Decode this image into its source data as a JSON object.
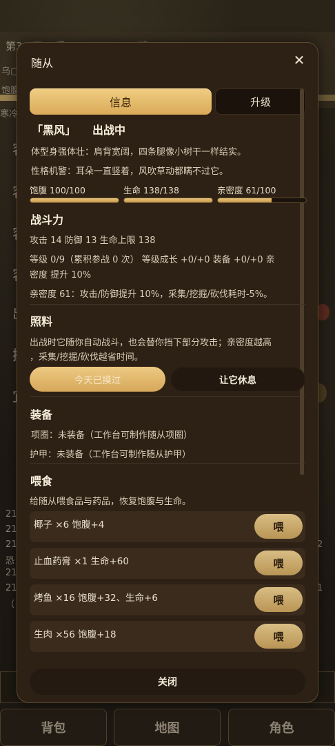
{
  "background": {
    "header_text": "第3▢天  ▢季  ▢▢:▢▢  ▢▢  晴▢",
    "sub_line_1": "乌▢",
    "sub_line_2": "饱腹",
    "sub_line_3": "寒冷",
    "side_chars": [
      "容",
      "容",
      "容",
      "容",
      "出",
      "挤",
      "宜"
    ],
    "log_left": [
      "21",
      "21",
      "21",
      "恐",
      "21",
      "21",
      "（"
    ],
    "log_right": [
      "2",
      "1"
    ],
    "nav": [
      "背包",
      "地图",
      "角色"
    ]
  },
  "modal": {
    "title": "随从",
    "close_icon": "close-icon",
    "tabs": {
      "info": "信息",
      "upgrade": "升级"
    },
    "pet_name": "「黑风」",
    "pet_status": "出战中",
    "desc_1": "体型身强体壮：肩背宽阔，四条腿像小树干一样结实。",
    "desc_2": "性格机警：耳朵一直竖着，风吹草动都瞒不过它。",
    "stats": [
      {
        "label": "饱腹 100/100",
        "fill": 1.0
      },
      {
        "label": "生命 138/138",
        "fill": 1.0
      },
      {
        "label": "亲密度 61/100",
        "fill": 0.61
      }
    ],
    "combat": {
      "title": "战斗力",
      "line_1": "攻击 14    防御 13    生命上限 138",
      "line_2": "等级 0/9（累积参战 0 次）     等级成长 +0/+0     装备 +0/+0     亲",
      "line_3": "密度 提升 10%",
      "line_4": "亲密度 61：攻击/防御提升 10%，采集/挖掘/砍伐耗时-5%。"
    },
    "care": {
      "title": "照料",
      "line_1": "出战时它随你自动战斗，也会替你挡下部分攻击；亲密度越高",
      "line_2": "，采集/挖掘/砍伐越省时间。",
      "pet_button": "今天已摸过",
      "rest_button": "让它休息"
    },
    "equipment": {
      "title": "装备",
      "collar": "项圈：未装备（工作台可制作随从项圈）",
      "armor": "护甲：未装备（工作台可制作随从护甲）"
    },
    "feeding": {
      "title": "喂食",
      "hint": "给随从喂食品与药品，恢复饱腹与生命。",
      "button_label": "喂",
      "items": [
        {
          "text": "椰子 ×6    饱腹+4"
        },
        {
          "text": "止血药膏 ×1    生命+60"
        },
        {
          "text": "烤鱼 ×16    饱腹+32、生命+6"
        },
        {
          "text": "生肉 ×56    饱腹+18"
        }
      ]
    },
    "close_label": "关闭"
  }
}
